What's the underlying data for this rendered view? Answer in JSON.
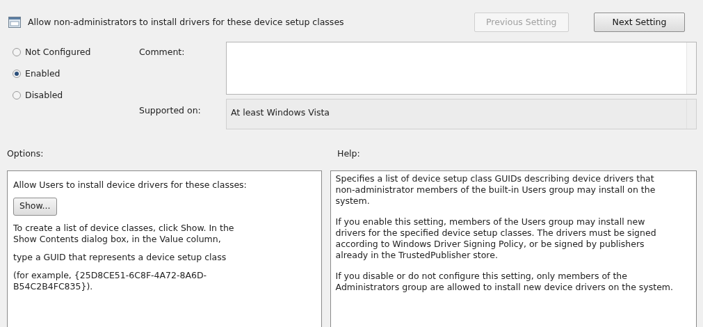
{
  "header": {
    "title": "Allow non-administrators to install drivers for these device setup classes"
  },
  "buttons": [
    {
      "label": "Previous Setting",
      "disabled": true
    },
    {
      "label": "Next Setting",
      "disabled": false
    }
  ],
  "states": [
    {
      "label": "Not Configured",
      "selected": false
    },
    {
      "label": "Enabled",
      "selected": true
    },
    {
      "label": "Disabled",
      "selected": false
    }
  ],
  "comment": {
    "label": "Comment:"
  },
  "supported_on": {
    "label": "Supported on:",
    "value": "At least Windows Vista"
  },
  "options": {
    "label": "Options:",
    "paragraphs": [
      "Allow Users to install device drivers for these classes:",
      "To create a list of device classes, click Show. In the Show Contents dialog box, in the Value column,",
      "type a GUID that represents a device setup class",
      "(for example, {25D8CE51-6C8F-4A72-8A6D-B54C2B4FC835})."
    ],
    "show_button": "Show..."
  },
  "help": {
    "label": "Help:",
    "paragraphs": [
      "Specifies a list of device setup class GUIDs describing device drivers that non-administrator members of the built-in Users group may install on the system.",
      "If you enable this setting, members of the Users group may install new drivers for the specified device setup classes. The drivers must be signed according to Windows Driver Signing Policy, or be signed by publishers already in the TrustedPublisher store.",
      "If you disable or do not configure this setting, only members of the Administrators group are allowed to install new device drivers on the system."
    ]
  }
}
